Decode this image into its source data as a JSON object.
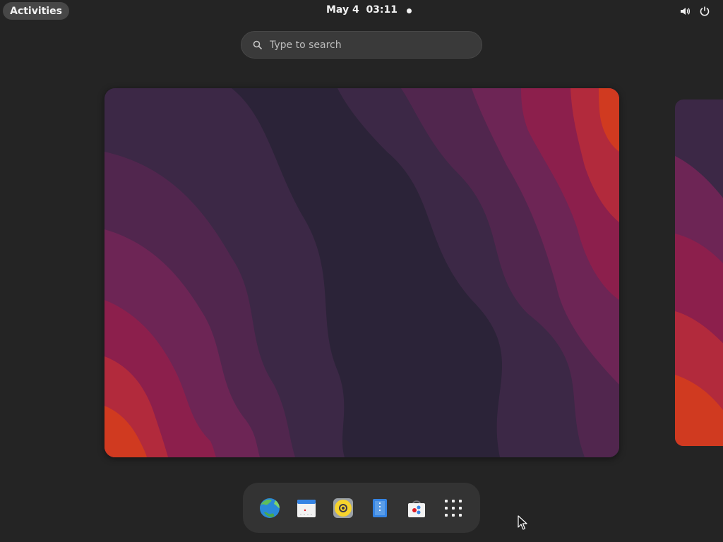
{
  "topbar": {
    "activities_label": "Activities",
    "clock": "May 4  03:11",
    "status_icons": [
      "volume-icon",
      "power-icon"
    ]
  },
  "search": {
    "placeholder": "Type to search"
  },
  "workspaces": {
    "count_visible": 2,
    "wallpaper_colors": [
      "#2b2338",
      "#3c2846",
      "#51264e",
      "#6d2555",
      "#8c1f4c",
      "#b22a3c",
      "#d03a20"
    ]
  },
  "dash": {
    "items": [
      {
        "name": "web-browser",
        "icon": "globe-icon"
      },
      {
        "name": "calendar",
        "icon": "calendar-icon"
      },
      {
        "name": "rhythmbox",
        "icon": "music-disc-icon"
      },
      {
        "name": "text-editor",
        "icon": "document-icon"
      },
      {
        "name": "software",
        "icon": "shopping-bag-icon"
      },
      {
        "name": "show-apps",
        "icon": "app-grid-icon"
      }
    ]
  }
}
